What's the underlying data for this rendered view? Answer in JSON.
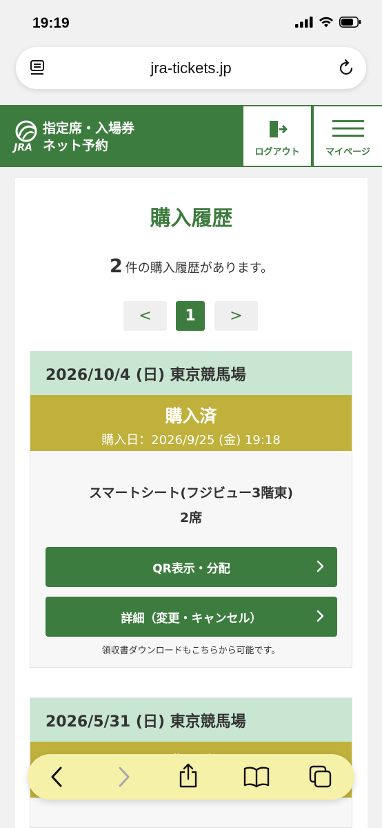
{
  "status_bar": {
    "time": "19:19"
  },
  "browser": {
    "url": "jra-tickets.jp"
  },
  "header": {
    "logo_line1": "指定席・入場券",
    "logo_line2": "ネット予約",
    "logo_mark_text": "JRA",
    "logout_label": "ログアウト",
    "mypage_label": "マイページ",
    "brand_color": "#3d7c3f"
  },
  "page": {
    "title": "購入履歴",
    "count": "2",
    "count_suffix": "件の購入履歴があります。"
  },
  "pager": {
    "prev": "<",
    "current": "1",
    "next": ">"
  },
  "history": [
    {
      "date": "2026/10/4 (日) 東京競馬場",
      "status": "購入済",
      "purchase_date": "購入日：2026/9/25 (金) 19:18",
      "seat": "スマートシート(フジビュー3階東)",
      "seat_count": "2席",
      "qr_button": "QR表示・分配",
      "detail_button": "詳細（変更・キャンセル）",
      "receipt_note": "領収書ダウンロードもこちらから可能です。"
    },
    {
      "date": "2026/5/31 (日) 東京競馬場",
      "status": "購入済"
    }
  ],
  "colors": {
    "date_band": "#c8e6d2",
    "status_band": "#c0b13c",
    "toolbar": "#f6f1a8"
  }
}
